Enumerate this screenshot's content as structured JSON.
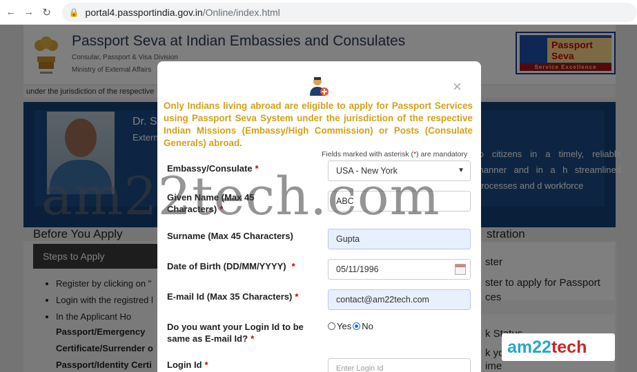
{
  "browser": {
    "url_host": "portal4.passportindia.gov.in",
    "url_path": "/Online/index.html"
  },
  "header": {
    "title": "Passport Seva at Indian Embassies and Consulates",
    "subtitle1": "Consular, Passport & Visa Division",
    "subtitle2": "Ministry of External Affairs",
    "logo_text": "Passport Seva",
    "logo_tagline": "Service Excellence"
  },
  "marquee": "under the jurisdiction of the respective",
  "banner": {
    "name": "Dr. S",
    "role": "Extern",
    "text": "to citizens in a timely, reliable manner and in a h streamlined processes and d workforce"
  },
  "left_panel": {
    "title": "Before You Apply",
    "steps_label": "Steps to Apply",
    "items": [
      "Register by clicking on \"",
      "Login with the registred l",
      "In the Applicant Ho"
    ],
    "bold_lines": [
      "Passport/Emergency",
      "Certificate/Surrender o",
      "Passport/Identity Certi"
    ]
  },
  "right_panel": {
    "title": "stration",
    "box1_title": "ster",
    "box1_text_1": "ster to apply for Passport",
    "box1_text_2": "ces",
    "box2_title": "k Status",
    "box2_text_1": "k yo",
    "box2_text_2": "ime"
  },
  "modal": {
    "notice": "Only Indians living abroad are eligible to apply for Passport Services using Passport Seva System under the jurisdiction of the respective Indian Missions (Embassy/High Commission) or Posts (Consulate Generals) abroad.",
    "mandatory_pre": "Fields marked with asterisk (",
    "mandatory_ast": "*",
    "mandatory_post": ") are mandatory",
    "close_symbol": "×",
    "required_mark": "*",
    "fields": {
      "embassy_label": "Embassy/Consulate",
      "embassy_value": "USA - New York",
      "given_name_label_1": "Given Name (Max 45",
      "given_name_label_2": "Characters)",
      "given_name_value": "ABC",
      "surname_label": "Surname (Max 45 Characters)",
      "surname_value": "Gupta",
      "dob_label": "Date of Birth (DD/MM/YYYY)",
      "dob_value": "05/11/1996",
      "email_label": "E-mail Id (Max 35 Characters)",
      "email_value": "contact@am22tech.com",
      "same_login_label_1": "Do you want your Login Id to be",
      "same_login_label_2": "same as E-mail Id?",
      "radio_yes": "Yes",
      "radio_no": "No",
      "radio_selected": "No",
      "login_label": "Login Id",
      "login_placeholder": "Enter Login Id"
    }
  },
  "watermark": {
    "text": "am22tech.com",
    "logo_a": "am22",
    "logo_b": "tech"
  },
  "colors": {
    "notice": "#d4a017",
    "required": "#cc0000",
    "banner": "#123f75",
    "filled_field": "#e8f0fe"
  }
}
